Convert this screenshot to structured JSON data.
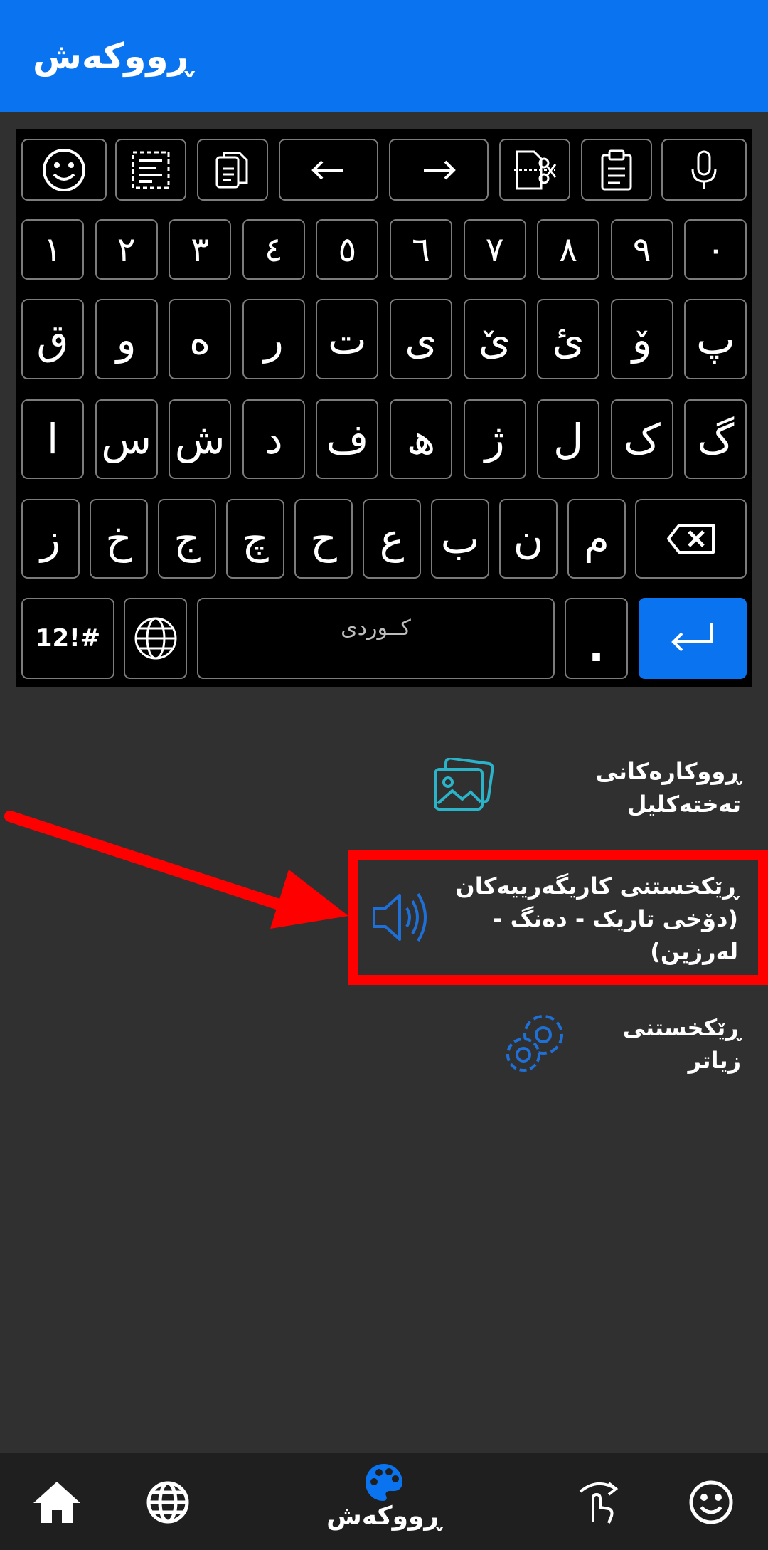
{
  "appbar": {
    "title": "ڕووکەش"
  },
  "keyboard": {
    "toolbar_icons": [
      "emoji-icon",
      "select-all-icon",
      "copy-icon",
      "arrow-left-icon",
      "arrow-right-icon",
      "cut-icon",
      "clipboard-icon",
      "microphone-icon"
    ],
    "row_numbers": [
      "١",
      "٢",
      "٣",
      "٤",
      "٥",
      "٦",
      "٧",
      "٨",
      "٩",
      "٠"
    ],
    "row1": [
      "ق",
      "و",
      "ە",
      "ر",
      "ت",
      "ی",
      "ێ",
      "ئ",
      "ۆ",
      "پ"
    ],
    "row2": [
      "ا",
      "س",
      "ش",
      "د",
      "ف",
      "ھ",
      "ژ",
      "ل",
      "ک",
      "گ"
    ],
    "row3": [
      "ز",
      "خ",
      "ج",
      "چ",
      "ح",
      "ع",
      "ب",
      "ن",
      "م"
    ],
    "symbols_label": "12!#",
    "space_label": "کــوردی",
    "dot_label": "."
  },
  "menu": {
    "themes": "ڕووکارەکانی تەختەکلیل",
    "effects_line1": "ڕێکخستنی کاریگەرییەکان",
    "effects_line2": "(دۆخی تاریک - دەنگ - لەرزین)",
    "more": "ڕێکخستنی زیاتر"
  },
  "bottom_nav": {
    "items": [
      "home-icon",
      "globe-icon",
      "palette-icon",
      "gesture-icon",
      "emoji-icon"
    ],
    "active_label": "ڕووکەش"
  },
  "colors": {
    "accent": "#0a74f0",
    "highlight": "#ff0000",
    "background": "#303030",
    "icon_cyan": "#2bb3c9"
  }
}
